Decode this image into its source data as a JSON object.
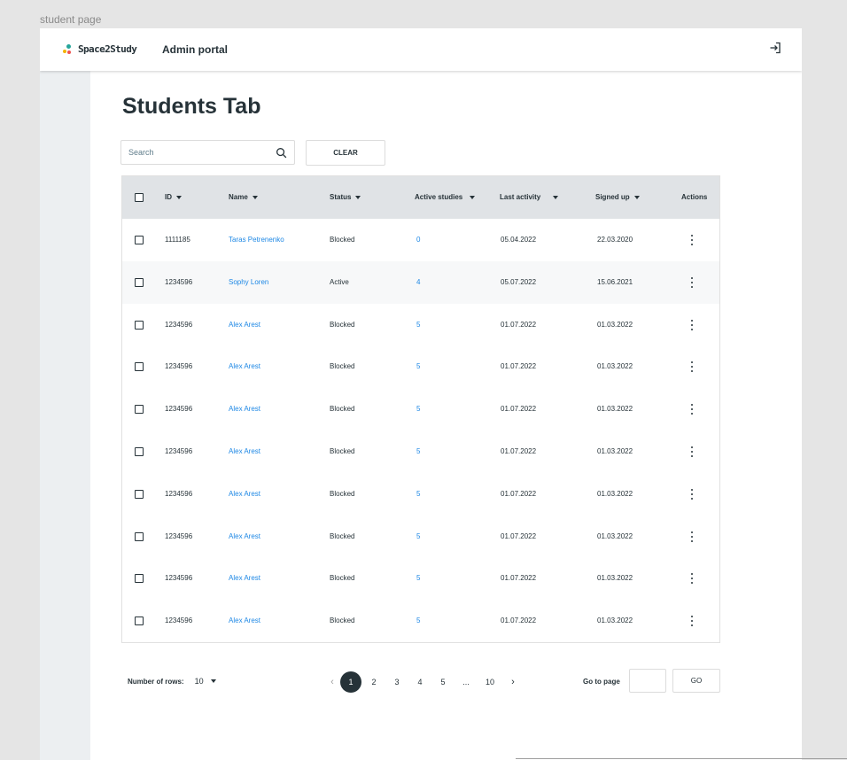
{
  "frame_label": "student page",
  "header": {
    "logo_text": "Space2Study",
    "portal_title": "Admin portal",
    "logout_icon": "logout-icon"
  },
  "page_title": "Students Tab",
  "search": {
    "placeholder": "Search",
    "value": ""
  },
  "clear_label": "CLEAR",
  "table": {
    "columns": [
      "ID",
      "Name",
      "Status",
      "Active studies",
      "Last activity",
      "Signed up",
      "Actions"
    ],
    "rows": [
      {
        "id": "1111185",
        "name": "Taras Petrenenko",
        "status": "Blocked",
        "active": "0",
        "last": "05.04.2022",
        "signed": "22.03.2020"
      },
      {
        "id": "1234596",
        "name": "Sophy Loren",
        "status": "Active",
        "active": "4",
        "last": "05.07.2022",
        "signed": "15.06.2021"
      },
      {
        "id": "1234596",
        "name": "Alex Arest",
        "status": "Blocked",
        "active": "5",
        "last": "01.07.2022",
        "signed": "01.03.2022"
      },
      {
        "id": "1234596",
        "name": "Alex Arest",
        "status": "Blocked",
        "active": "5",
        "last": "01.07.2022",
        "signed": "01.03.2022"
      },
      {
        "id": "1234596",
        "name": "Alex Arest",
        "status": "Blocked",
        "active": "5",
        "last": "01.07.2022",
        "signed": "01.03.2022"
      },
      {
        "id": "1234596",
        "name": "Alex Arest",
        "status": "Blocked",
        "active": "5",
        "last": "01.07.2022",
        "signed": "01.03.2022"
      },
      {
        "id": "1234596",
        "name": "Alex Arest",
        "status": "Blocked",
        "active": "5",
        "last": "01.07.2022",
        "signed": "01.03.2022"
      },
      {
        "id": "1234596",
        "name": "Alex Arest",
        "status": "Blocked",
        "active": "5",
        "last": "01.07.2022",
        "signed": "01.03.2022"
      },
      {
        "id": "1234596",
        "name": "Alex Arest",
        "status": "Blocked",
        "active": "5",
        "last": "01.07.2022",
        "signed": "01.03.2022"
      },
      {
        "id": "1234596",
        "name": "Alex Arest",
        "status": "Blocked",
        "active": "5",
        "last": "01.07.2022",
        "signed": "01.03.2022"
      }
    ]
  },
  "pagination": {
    "rows_label": "Number of rows:",
    "rows_value": "10",
    "prev": "‹",
    "next": "›",
    "pages": [
      "1",
      "2",
      "3",
      "4",
      "5",
      "...",
      "10"
    ],
    "current": "1",
    "goto_label": "Go to page",
    "go_label": "GO"
  },
  "colors": {
    "link": "#1e88e5",
    "active_page": "#263238",
    "header_row": "#e0e3e6"
  }
}
